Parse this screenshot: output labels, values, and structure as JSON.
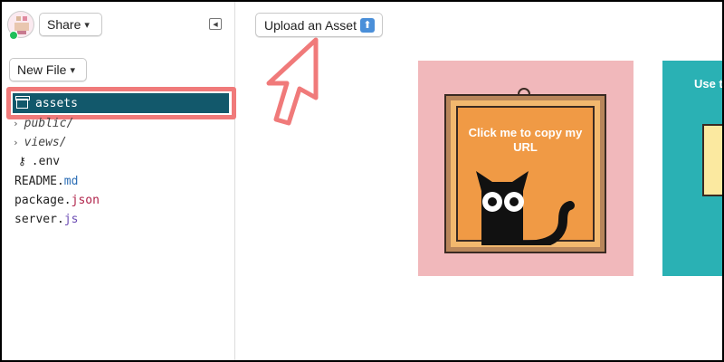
{
  "sidebar": {
    "share_label": "Share",
    "new_file_label": "New File",
    "files": [
      {
        "name": "assets",
        "type": "folder",
        "selected": true
      },
      {
        "name": "public/",
        "type": "folder"
      },
      {
        "name": "views/",
        "type": "folder"
      },
      {
        "name": ".env",
        "type": "file"
      },
      {
        "base": "README.",
        "ext": "md"
      },
      {
        "base": "package.",
        "ext": "json"
      },
      {
        "base": "server.",
        "ext": "js"
      }
    ]
  },
  "main": {
    "upload_label": "Upload an Asset",
    "cards": [
      {
        "text": "Click me to copy my URL",
        "background": "#f1b8bb"
      },
      {
        "text": "Use t",
        "background": "#2ab1b4"
      }
    ]
  },
  "colors": {
    "selected_row": "#12586b",
    "highlight": "#f07a7a",
    "online": "#1fbf5a"
  },
  "icons": {
    "avatar": "avatar",
    "collapse": "collapse-sidebar-icon",
    "assets": "box-icon",
    "env": "key-icon",
    "upload": "upload-arrow-icon"
  }
}
